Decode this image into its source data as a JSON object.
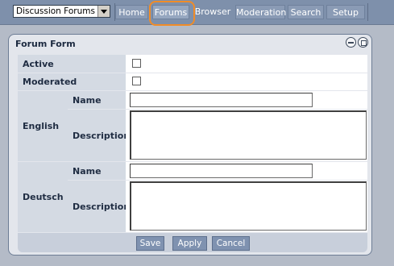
{
  "nav": {
    "module_select": "Discussion Forums",
    "tabs": [
      "Home",
      "Forums",
      "Browser",
      "Moderation",
      "Search",
      "Setup"
    ],
    "active_tab": "Forums"
  },
  "panel": {
    "title": "Forum Form",
    "rows": {
      "active_label": "Active",
      "moderated_label": "Moderated"
    },
    "languages": [
      {
        "group": "English",
        "name_label": "Name",
        "description_label": "Description",
        "name_value": "",
        "description_value": ""
      },
      {
        "group": "Deutsch",
        "name_label": "Name",
        "description_label": "Description",
        "name_value": "",
        "description_value": ""
      }
    ],
    "buttons": {
      "save": "Save",
      "apply": "Apply",
      "cancel": "Cancel"
    }
  },
  "colors": {
    "highlight": "#f08c28",
    "nav": "#7e90ab",
    "button": "#7f92b0"
  }
}
